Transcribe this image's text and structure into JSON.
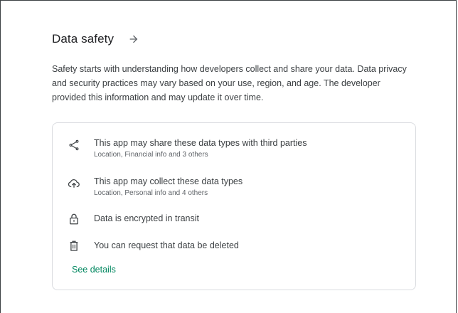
{
  "section": {
    "title": "Data safety",
    "description": "Safety starts with understanding how developers collect and share your data. Data privacy and security practices may vary based on your use, region, and age. The developer provided this information and may update it over time."
  },
  "card": {
    "items": [
      {
        "icon": "share-icon",
        "title": "This app may share these data types with third parties",
        "subtitle": "Location, Financial info and 3 others"
      },
      {
        "icon": "cloud-upload-icon",
        "title": "This app may collect these data types",
        "subtitle": "Location, Personal info and 4 others"
      },
      {
        "icon": "lock-icon",
        "title": "Data is encrypted in transit",
        "subtitle": ""
      },
      {
        "icon": "trash-icon",
        "title": "You can request that data be deleted",
        "subtitle": ""
      }
    ],
    "see_details_label": "See details"
  },
  "colors": {
    "accent": "#01875f",
    "text_primary": "#202124",
    "text_secondary": "#5f6368",
    "border": "#dadce0"
  }
}
